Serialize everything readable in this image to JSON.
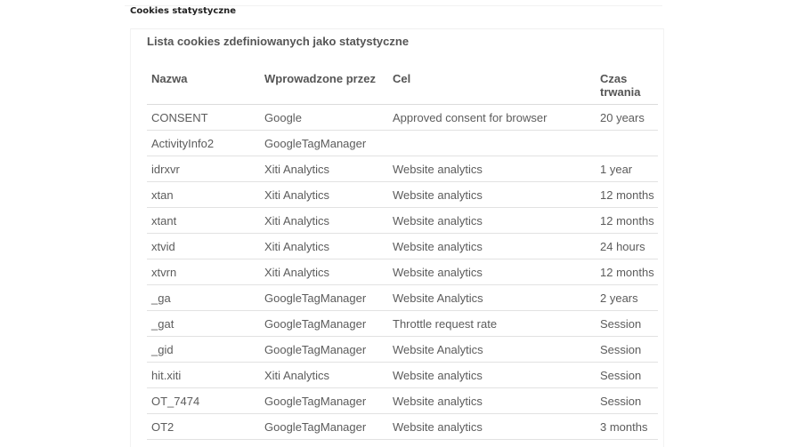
{
  "section": {
    "title": "Cookies statystyczne"
  },
  "panel": {
    "title": "Lista cookies zdefiniowanych jako statystyczne"
  },
  "table": {
    "headers": {
      "name": "Nazwa",
      "introduced_by": "Wprowadzone przez",
      "purpose": "Cel",
      "duration_line1": "Czas",
      "duration_line2": "trwania"
    },
    "rows": [
      {
        "name": "CONSENT",
        "introduced_by": "Google",
        "purpose": "Approved consent for browser",
        "duration": "20 years"
      },
      {
        "name": "ActivityInfo2",
        "introduced_by": "GoogleTagManager",
        "purpose": "",
        "duration": ""
      },
      {
        "name": "idrxvr",
        "introduced_by": "Xiti Analytics",
        "purpose": "Website analytics",
        "duration": "1 year"
      },
      {
        "name": "xtan",
        "introduced_by": "Xiti Analytics",
        "purpose": "Website analytics",
        "duration": "12 months"
      },
      {
        "name": "xtant",
        "introduced_by": "Xiti Analytics",
        "purpose": "Website analytics",
        "duration": "12 months"
      },
      {
        "name": "xtvid",
        "introduced_by": "Xiti Analytics",
        "purpose": "Website analytics",
        "duration": "24 hours"
      },
      {
        "name": "xtvrn",
        "introduced_by": "Xiti Analytics",
        "purpose": "Website analytics",
        "duration": "12 months"
      },
      {
        "name": "_ga",
        "introduced_by": "GoogleTagManager",
        "purpose": "Website Analytics",
        "duration": "2 years"
      },
      {
        "name": "_gat",
        "introduced_by": "GoogleTagManager",
        "purpose": "Throttle request rate",
        "duration": "Session"
      },
      {
        "name": "_gid",
        "introduced_by": "GoogleTagManager",
        "purpose": "Website Analytics",
        "duration": "Session"
      },
      {
        "name": "hit.xiti",
        "introduced_by": "Xiti Analytics",
        "purpose": "Website analytics",
        "duration": "Session"
      },
      {
        "name": "OT_7474",
        "introduced_by": "GoogleTagManager",
        "purpose": "Website analytics",
        "duration": "Session"
      },
      {
        "name": "OT2",
        "introduced_by": "GoogleTagManager",
        "purpose": "Website analytics",
        "duration": "3 months"
      }
    ]
  }
}
